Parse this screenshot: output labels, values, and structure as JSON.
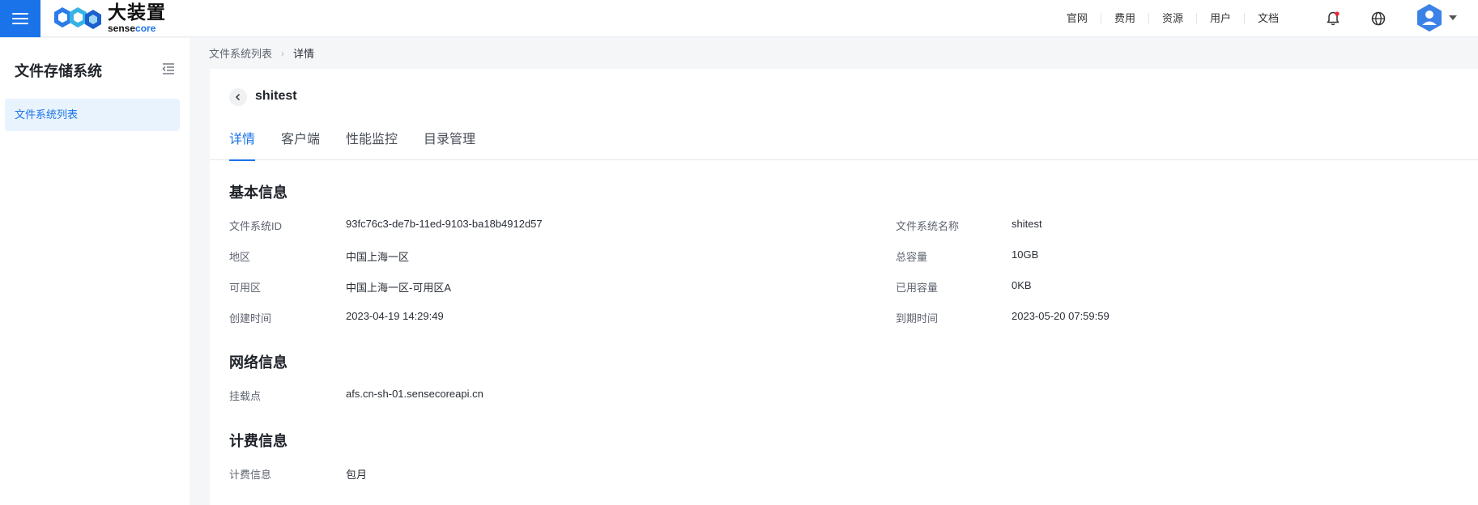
{
  "header": {
    "logo_cn": "大装置",
    "logo_en_prefix": "sense",
    "logo_en_suffix": "core",
    "nav": [
      "官网",
      "费用",
      "资源",
      "用户",
      "文档"
    ],
    "accent_color": "#1a73e8",
    "notification_dot_color": "#f5222d"
  },
  "sidebar": {
    "title": "文件存储系统",
    "items": [
      {
        "label": "文件系统列表",
        "active": true
      }
    ]
  },
  "breadcrumb": {
    "items": [
      "文件系统列表",
      "详情"
    ]
  },
  "page": {
    "title": "shitest",
    "tabs": [
      {
        "label": "详情",
        "active": true
      },
      {
        "label": "客户端",
        "active": false
      },
      {
        "label": "性能监控",
        "active": false
      },
      {
        "label": "目录管理",
        "active": false
      }
    ]
  },
  "basic": {
    "title": "基本信息",
    "left": [
      {
        "label": "文件系统ID",
        "value": "93fc76c3-de7b-11ed-9103-ba18b4912d57"
      },
      {
        "label": "地区",
        "value": "中国上海一区"
      },
      {
        "label": "可用区",
        "value": "中国上海一区-可用区A"
      },
      {
        "label": "创建时间",
        "value": "2023-04-19 14:29:49"
      }
    ],
    "right": [
      {
        "label": "文件系统名称",
        "value": "shitest"
      },
      {
        "label": "总容量",
        "value": "10GB"
      },
      {
        "label": "已用容量",
        "value": "0KB"
      },
      {
        "label": "到期时间",
        "value": "2023-05-20 07:59:59"
      }
    ]
  },
  "network": {
    "title": "网络信息",
    "rows": [
      {
        "label": "挂载点",
        "value": "afs.cn-sh-01.sensecoreapi.cn"
      }
    ]
  },
  "billing": {
    "title": "计费信息",
    "rows": [
      {
        "label": "计费信息",
        "value": "包月"
      }
    ]
  }
}
